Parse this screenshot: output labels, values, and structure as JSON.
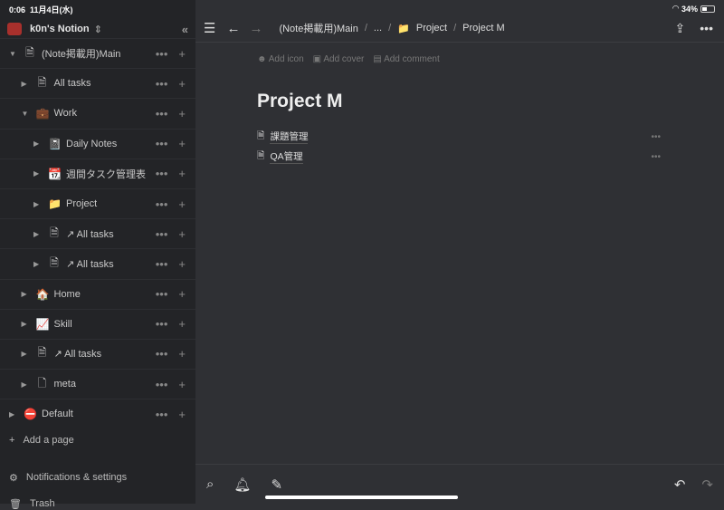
{
  "status": {
    "time": "0:06",
    "date": "11月4日(水)",
    "battery": "34%",
    "battery_level": 34
  },
  "sidebar": {
    "workspace": "k0n's Notion",
    "items": [
      {
        "label": "(Note掲載用)Main",
        "icon": "page-icon",
        "glyph": "🗎",
        "level": 0,
        "arrow": "▼"
      },
      {
        "label": "All tasks",
        "icon": "page-icon",
        "glyph": "🗎",
        "level": 1,
        "arrow": "▶"
      },
      {
        "label": "Work",
        "icon": "briefcase-icon",
        "glyph": "💼",
        "level": 1,
        "arrow": "▼"
      },
      {
        "label": "Daily Notes",
        "icon": "notebook-icon",
        "glyph": "📓",
        "level": 2,
        "arrow": "▶"
      },
      {
        "label": "週間タスク管理表",
        "icon": "calendar-icon",
        "glyph": "📆",
        "level": 2,
        "arrow": "▶"
      },
      {
        "label": "Project",
        "icon": "folder-icon",
        "glyph": "📁",
        "level": 2,
        "arrow": "▶"
      },
      {
        "label": "↗ All tasks",
        "icon": "page-icon",
        "glyph": "🗎",
        "level": 2,
        "arrow": "▶"
      },
      {
        "label": "↗ All tasks",
        "icon": "page-icon",
        "glyph": "🗎",
        "level": 2,
        "arrow": "▶"
      },
      {
        "label": "Home",
        "icon": "house-icon",
        "glyph": "🏠",
        "level": 1,
        "arrow": "▶"
      },
      {
        "label": "Skill",
        "icon": "chart-icon",
        "glyph": "📈",
        "level": 1,
        "arrow": "▶"
      },
      {
        "label": "↗ All tasks",
        "icon": "page-icon",
        "glyph": "🗎",
        "level": 1,
        "arrow": "▶"
      },
      {
        "label": "meta",
        "icon": "page-icon",
        "glyph": "🗋",
        "level": 1,
        "arrow": "▶"
      },
      {
        "label": "Default",
        "icon": "no-entry-icon",
        "glyph": "⛔",
        "level": 0,
        "arrow": "▶"
      }
    ],
    "add_page": "Add a page",
    "notifications": "Notifications & settings",
    "trash": "Trash"
  },
  "header": {
    "breadcrumbs": [
      "(Note掲載用)Main",
      "...",
      "Project",
      "Project M"
    ]
  },
  "page": {
    "add_icon": "Add icon",
    "add_cover": "Add cover",
    "add_comment": "Add comment",
    "title": "Project M",
    "subpages": [
      "課題管理",
      "QA管理"
    ]
  }
}
